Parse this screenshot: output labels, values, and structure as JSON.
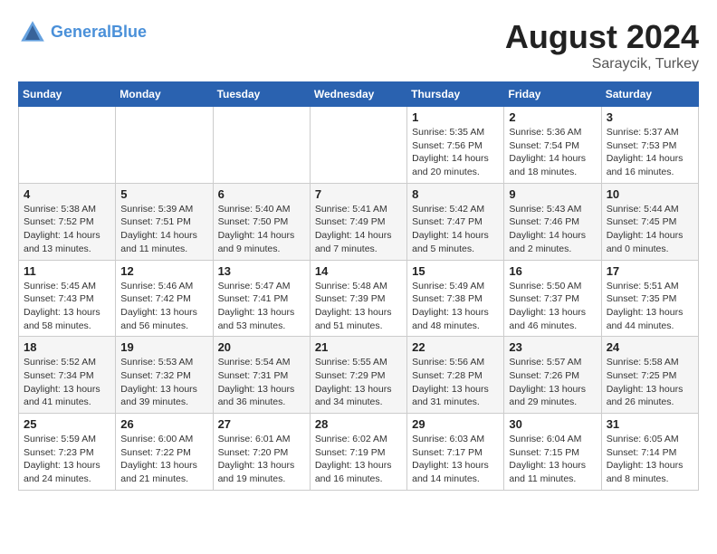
{
  "header": {
    "logo_line1": "General",
    "logo_line2": "Blue",
    "month_year": "August 2024",
    "location": "Saraycik, Turkey"
  },
  "days_of_week": [
    "Sunday",
    "Monday",
    "Tuesday",
    "Wednesday",
    "Thursday",
    "Friday",
    "Saturday"
  ],
  "weeks": [
    [
      {
        "day": "",
        "info": ""
      },
      {
        "day": "",
        "info": ""
      },
      {
        "day": "",
        "info": ""
      },
      {
        "day": "",
        "info": ""
      },
      {
        "day": "1",
        "info": "Sunrise: 5:35 AM\nSunset: 7:56 PM\nDaylight: 14 hours and 20 minutes."
      },
      {
        "day": "2",
        "info": "Sunrise: 5:36 AM\nSunset: 7:54 PM\nDaylight: 14 hours and 18 minutes."
      },
      {
        "day": "3",
        "info": "Sunrise: 5:37 AM\nSunset: 7:53 PM\nDaylight: 14 hours and 16 minutes."
      }
    ],
    [
      {
        "day": "4",
        "info": "Sunrise: 5:38 AM\nSunset: 7:52 PM\nDaylight: 14 hours and 13 minutes."
      },
      {
        "day": "5",
        "info": "Sunrise: 5:39 AM\nSunset: 7:51 PM\nDaylight: 14 hours and 11 minutes."
      },
      {
        "day": "6",
        "info": "Sunrise: 5:40 AM\nSunset: 7:50 PM\nDaylight: 14 hours and 9 minutes."
      },
      {
        "day": "7",
        "info": "Sunrise: 5:41 AM\nSunset: 7:49 PM\nDaylight: 14 hours and 7 minutes."
      },
      {
        "day": "8",
        "info": "Sunrise: 5:42 AM\nSunset: 7:47 PM\nDaylight: 14 hours and 5 minutes."
      },
      {
        "day": "9",
        "info": "Sunrise: 5:43 AM\nSunset: 7:46 PM\nDaylight: 14 hours and 2 minutes."
      },
      {
        "day": "10",
        "info": "Sunrise: 5:44 AM\nSunset: 7:45 PM\nDaylight: 14 hours and 0 minutes."
      }
    ],
    [
      {
        "day": "11",
        "info": "Sunrise: 5:45 AM\nSunset: 7:43 PM\nDaylight: 13 hours and 58 minutes."
      },
      {
        "day": "12",
        "info": "Sunrise: 5:46 AM\nSunset: 7:42 PM\nDaylight: 13 hours and 56 minutes."
      },
      {
        "day": "13",
        "info": "Sunrise: 5:47 AM\nSunset: 7:41 PM\nDaylight: 13 hours and 53 minutes."
      },
      {
        "day": "14",
        "info": "Sunrise: 5:48 AM\nSunset: 7:39 PM\nDaylight: 13 hours and 51 minutes."
      },
      {
        "day": "15",
        "info": "Sunrise: 5:49 AM\nSunset: 7:38 PM\nDaylight: 13 hours and 48 minutes."
      },
      {
        "day": "16",
        "info": "Sunrise: 5:50 AM\nSunset: 7:37 PM\nDaylight: 13 hours and 46 minutes."
      },
      {
        "day": "17",
        "info": "Sunrise: 5:51 AM\nSunset: 7:35 PM\nDaylight: 13 hours and 44 minutes."
      }
    ],
    [
      {
        "day": "18",
        "info": "Sunrise: 5:52 AM\nSunset: 7:34 PM\nDaylight: 13 hours and 41 minutes."
      },
      {
        "day": "19",
        "info": "Sunrise: 5:53 AM\nSunset: 7:32 PM\nDaylight: 13 hours and 39 minutes."
      },
      {
        "day": "20",
        "info": "Sunrise: 5:54 AM\nSunset: 7:31 PM\nDaylight: 13 hours and 36 minutes."
      },
      {
        "day": "21",
        "info": "Sunrise: 5:55 AM\nSunset: 7:29 PM\nDaylight: 13 hours and 34 minutes."
      },
      {
        "day": "22",
        "info": "Sunrise: 5:56 AM\nSunset: 7:28 PM\nDaylight: 13 hours and 31 minutes."
      },
      {
        "day": "23",
        "info": "Sunrise: 5:57 AM\nSunset: 7:26 PM\nDaylight: 13 hours and 29 minutes."
      },
      {
        "day": "24",
        "info": "Sunrise: 5:58 AM\nSunset: 7:25 PM\nDaylight: 13 hours and 26 minutes."
      }
    ],
    [
      {
        "day": "25",
        "info": "Sunrise: 5:59 AM\nSunset: 7:23 PM\nDaylight: 13 hours and 24 minutes."
      },
      {
        "day": "26",
        "info": "Sunrise: 6:00 AM\nSunset: 7:22 PM\nDaylight: 13 hours and 21 minutes."
      },
      {
        "day": "27",
        "info": "Sunrise: 6:01 AM\nSunset: 7:20 PM\nDaylight: 13 hours and 19 minutes."
      },
      {
        "day": "28",
        "info": "Sunrise: 6:02 AM\nSunset: 7:19 PM\nDaylight: 13 hours and 16 minutes."
      },
      {
        "day": "29",
        "info": "Sunrise: 6:03 AM\nSunset: 7:17 PM\nDaylight: 13 hours and 14 minutes."
      },
      {
        "day": "30",
        "info": "Sunrise: 6:04 AM\nSunset: 7:15 PM\nDaylight: 13 hours and 11 minutes."
      },
      {
        "day": "31",
        "info": "Sunrise: 6:05 AM\nSunset: 7:14 PM\nDaylight: 13 hours and 8 minutes."
      }
    ]
  ]
}
